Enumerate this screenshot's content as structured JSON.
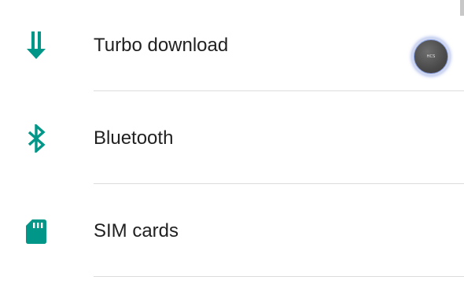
{
  "settings": {
    "items": [
      {
        "label": "Turbo download",
        "icon": "down-arrows-icon"
      },
      {
        "label": "Bluetooth",
        "icon": "bluetooth-icon"
      },
      {
        "label": "SIM cards",
        "icon": "sim-card-icon"
      }
    ]
  },
  "floating_badge": {
    "text": "HCS"
  },
  "colors": {
    "accent": "#009688",
    "text": "#212121",
    "divider": "#dcdcdc"
  }
}
